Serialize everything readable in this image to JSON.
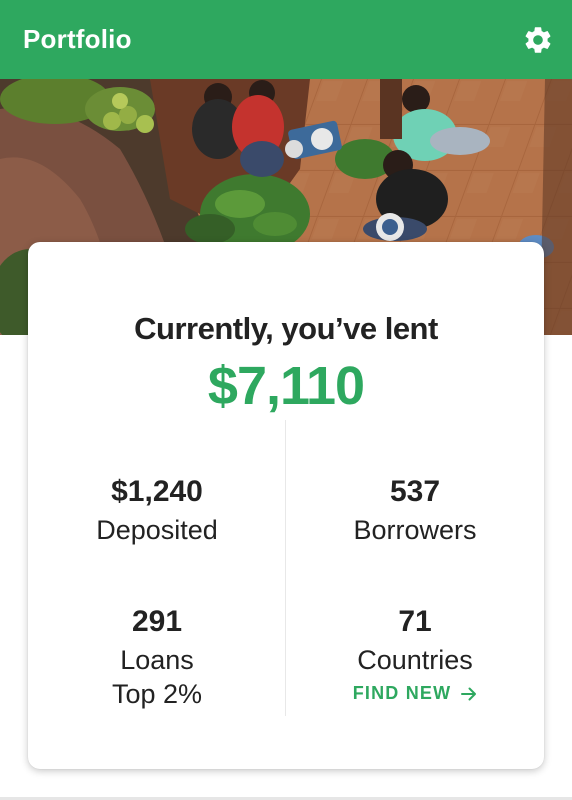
{
  "header": {
    "title": "Portfolio",
    "settings_icon": "gear-icon"
  },
  "hero": {
    "image": "photo of people sitting on a tiled terrace working with bowls and plants"
  },
  "portfolio": {
    "heading": "Currently, you’ve lent",
    "total_lent": "$7,110",
    "stats": {
      "deposited": {
        "value": "$1,240",
        "label": "Deposited"
      },
      "borrowers": {
        "value": "537",
        "label": "Borrowers"
      },
      "loans": {
        "value": "291",
        "label": "Loans",
        "sub": "Top 2%"
      },
      "countries": {
        "value": "71",
        "label": "Countries",
        "link": "FIND NEW",
        "link_icon": "arrow-right-icon"
      }
    }
  },
  "colors": {
    "accent": "#2ea85f",
    "text": "#222222",
    "header_text": "#ffffff"
  }
}
